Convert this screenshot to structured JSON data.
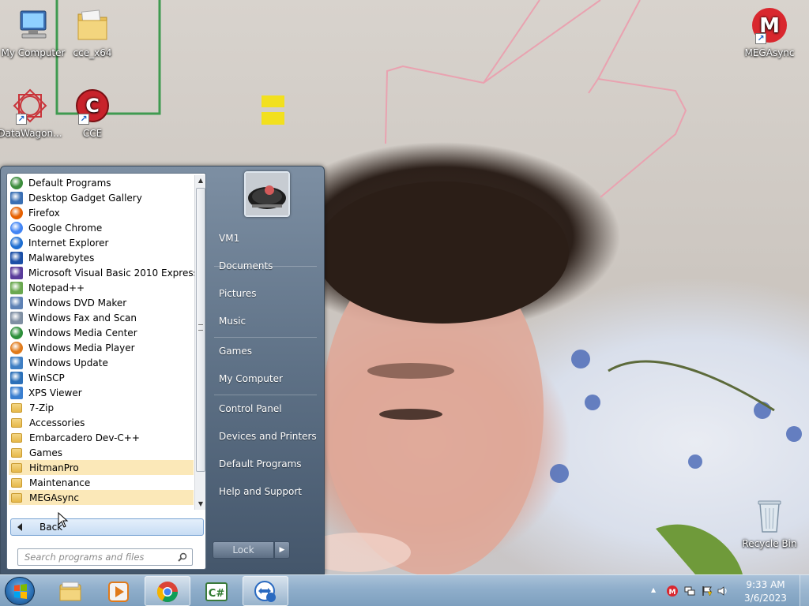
{
  "desktop": {
    "icons": [
      {
        "label": "My Computer",
        "icon": "computer-icon"
      },
      {
        "label": "cce_x64",
        "icon": "folder-icon"
      },
      {
        "label": "DataWagon...",
        "icon": "datawagon-icon"
      },
      {
        "label": "CCE",
        "icon": "cce-icon"
      },
      {
        "label": "MEGAsync",
        "icon": "mega-icon"
      },
      {
        "label": "Recycle Bin",
        "icon": "recycle-bin-icon"
      }
    ]
  },
  "start_menu": {
    "programs": [
      {
        "label": "Default Programs",
        "icon": "default-programs-icon"
      },
      {
        "label": "Desktop Gadget Gallery",
        "icon": "gadget-icon"
      },
      {
        "label": "Firefox",
        "icon": "firefox-icon"
      },
      {
        "label": "Google Chrome",
        "icon": "chrome-icon"
      },
      {
        "label": "Internet Explorer",
        "icon": "internet-explorer-icon"
      },
      {
        "label": "Malwarebytes",
        "icon": "malwarebytes-icon"
      },
      {
        "label": "Microsoft Visual Basic 2010 Express",
        "icon": "visual-basic-icon"
      },
      {
        "label": "Notepad++",
        "icon": "notepad-plus-plus-icon"
      },
      {
        "label": "Windows DVD Maker",
        "icon": "dvd-maker-icon"
      },
      {
        "label": "Windows Fax and Scan",
        "icon": "fax-scan-icon"
      },
      {
        "label": "Windows Media Center",
        "icon": "media-center-icon"
      },
      {
        "label": "Windows Media Player",
        "icon": "media-player-icon"
      },
      {
        "label": "Windows Update",
        "icon": "windows-update-icon"
      },
      {
        "label": "WinSCP",
        "icon": "winscp-icon"
      },
      {
        "label": "XPS Viewer",
        "icon": "xps-viewer-icon"
      },
      {
        "label": "7-Zip",
        "icon": "folder-icon"
      },
      {
        "label": "Accessories",
        "icon": "folder-icon"
      },
      {
        "label": "Embarcadero Dev-C++",
        "icon": "folder-icon"
      },
      {
        "label": "Games",
        "icon": "folder-icon"
      },
      {
        "label": "HitmanPro",
        "icon": "folder-icon"
      },
      {
        "label": "Maintenance",
        "icon": "folder-icon"
      },
      {
        "label": "MEGAsync",
        "icon": "folder-icon"
      }
    ],
    "back_label": "Back",
    "search_placeholder": "Search programs and files",
    "right_items": [
      "VM1",
      "Documents",
      "Pictures",
      "Music",
      "Games",
      "My Computer",
      "Control Panel",
      "Devices and Printers",
      "Default Programs",
      "Help and Support"
    ],
    "lock_label": "Lock",
    "lock_arrow": "▶"
  },
  "taskbar": {
    "buttons": [
      {
        "icon": "explorer-icon"
      },
      {
        "icon": "media-player-icon"
      },
      {
        "icon": "chrome-icon"
      },
      {
        "icon": "csharp-icon"
      },
      {
        "icon": "teamviewer-icon"
      }
    ],
    "clock_time": "9:33 AM",
    "clock_date": "3/6/2023",
    "tray_expand": "▲"
  },
  "colors": {
    "highlight": "#fbe8b8",
    "taskbar": "#8faecb",
    "start_menu": "#5e7186",
    "mega_red": "#d9272e"
  }
}
